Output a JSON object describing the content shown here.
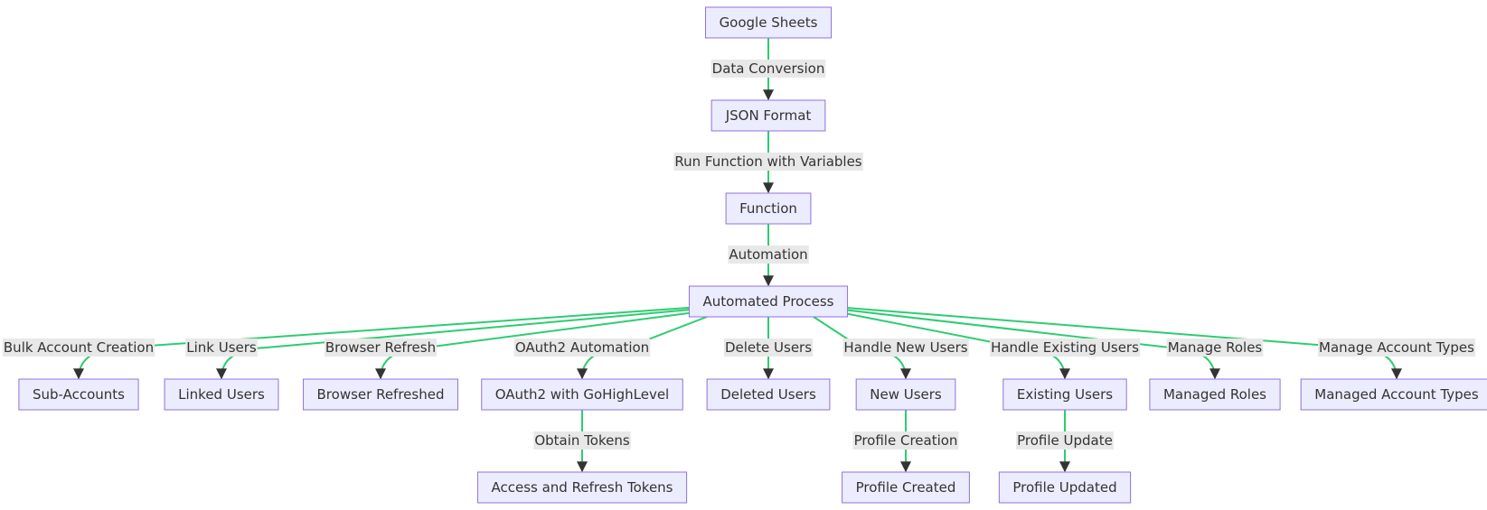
{
  "diagram": {
    "type": "flowchart",
    "direction": "top-down",
    "colors": {
      "node_fill": "#ECECFF",
      "node_border": "#9370DB",
      "edge": "#2ecc71",
      "label_bg": "#e8e8e8",
      "text": "#333333"
    },
    "nodes": [
      {
        "id": "sheets",
        "label": "Google Sheets"
      },
      {
        "id": "json",
        "label": "JSON Format"
      },
      {
        "id": "func",
        "label": "Function"
      },
      {
        "id": "auto",
        "label": "Automated Process"
      },
      {
        "id": "sub",
        "label": "Sub-Accounts"
      },
      {
        "id": "linked",
        "label": "Linked Users"
      },
      {
        "id": "browser",
        "label": "Browser Refreshed"
      },
      {
        "id": "oauth",
        "label": "OAuth2 with GoHighLevel"
      },
      {
        "id": "deleted",
        "label": "Deleted Users"
      },
      {
        "id": "newu",
        "label": "New Users"
      },
      {
        "id": "exist",
        "label": "Existing Users"
      },
      {
        "id": "roles",
        "label": "Managed Roles"
      },
      {
        "id": "acct",
        "label": "Managed Account Types"
      },
      {
        "id": "tokens",
        "label": "Access and Refresh Tokens"
      },
      {
        "id": "pcreated",
        "label": "Profile Created"
      },
      {
        "id": "pupdated",
        "label": "Profile Updated"
      }
    ],
    "edges": [
      {
        "from": "sheets",
        "to": "json",
        "label": "Data Conversion"
      },
      {
        "from": "json",
        "to": "func",
        "label": "Run Function with Variables"
      },
      {
        "from": "func",
        "to": "auto",
        "label": "Automation"
      },
      {
        "from": "auto",
        "to": "sub",
        "label": "Bulk Account Creation"
      },
      {
        "from": "auto",
        "to": "linked",
        "label": "Link Users"
      },
      {
        "from": "auto",
        "to": "browser",
        "label": "Browser Refresh"
      },
      {
        "from": "auto",
        "to": "oauth",
        "label": "OAuth2 Automation"
      },
      {
        "from": "auto",
        "to": "deleted",
        "label": "Delete Users"
      },
      {
        "from": "auto",
        "to": "newu",
        "label": "Handle New Users"
      },
      {
        "from": "auto",
        "to": "exist",
        "label": "Handle Existing Users"
      },
      {
        "from": "auto",
        "to": "roles",
        "label": "Manage Roles"
      },
      {
        "from": "auto",
        "to": "acct",
        "label": "Manage Account Types"
      },
      {
        "from": "oauth",
        "to": "tokens",
        "label": "Obtain Tokens"
      },
      {
        "from": "newu",
        "to": "pcreated",
        "label": "Profile Creation"
      },
      {
        "from": "exist",
        "to": "pupdated",
        "label": "Profile Update"
      }
    ]
  }
}
